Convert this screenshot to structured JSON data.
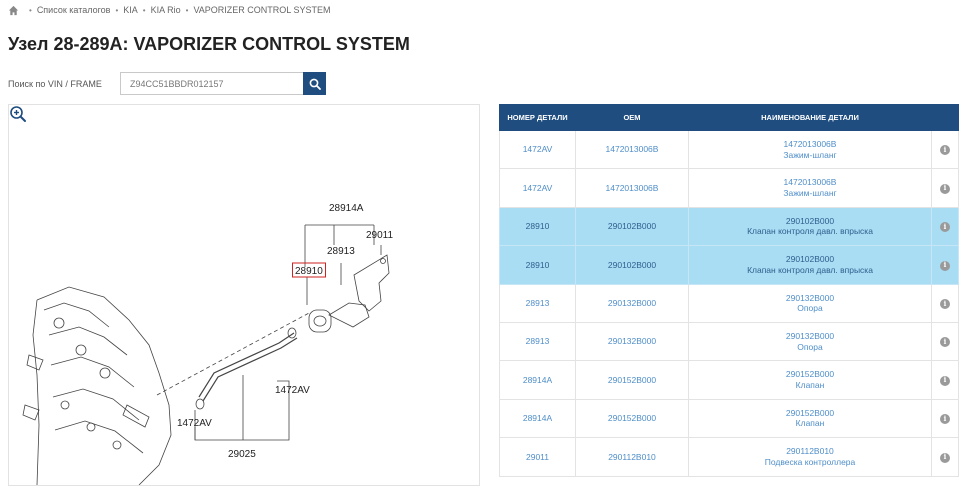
{
  "breadcrumb": {
    "items": [
      "Список каталогов",
      "KIA",
      "KIA Rio",
      "VAPORIZER CONTROL SYSTEM"
    ]
  },
  "page": {
    "title": "Узел 28-289A: VAPORIZER CONTROL SYSTEM"
  },
  "search": {
    "label": "Поиск по VIN / FRAME",
    "value": "Z94CC51BBDR012157",
    "icon": "search-icon"
  },
  "diagram": {
    "labels": {
      "l28914A": "28914A",
      "l28913": "28913",
      "l29011": "29011",
      "l28910": "28910",
      "l1472AV_right": "1472AV",
      "l1472AV_left": "1472AV",
      "l29025": "29025"
    },
    "zoom_icon": "zoom-in-icon",
    "highlight_color": "#cc2222"
  },
  "table": {
    "headers": {
      "part_number": "НОМЕР ДЕТАЛИ",
      "oem": "OEM",
      "name": "НАИМЕНОВАНИЕ ДЕТАЛИ"
    },
    "rows": [
      {
        "part": "1472AV",
        "oem": "1472013006B",
        "code": "1472013006B",
        "name": "Зажим-шланг",
        "highlighted": false
      },
      {
        "part": "1472AV",
        "oem": "1472013006B",
        "code": "1472013006B",
        "name": "Зажим-шланг",
        "highlighted": false
      },
      {
        "part": "28910",
        "oem": "290102B000",
        "code": "290102B000",
        "name": "Клапан контроля давл. впрыска",
        "highlighted": true
      },
      {
        "part": "28910",
        "oem": "290102B000",
        "code": "290102B000",
        "name": "Клапан контроля давл. впрыска",
        "highlighted": true
      },
      {
        "part": "28913",
        "oem": "290132B000",
        "code": "290132B000",
        "name": "Опора",
        "highlighted": false
      },
      {
        "part": "28913",
        "oem": "290132B000",
        "code": "290132B000",
        "name": "Опора",
        "highlighted": false
      },
      {
        "part": "28914A",
        "oem": "290152B000",
        "code": "290152B000",
        "name": "Клапан",
        "highlighted": false
      },
      {
        "part": "28914A",
        "oem": "290152B000",
        "code": "290152B000",
        "name": "Клапан",
        "highlighted": false
      },
      {
        "part": "29011",
        "oem": "290112B010",
        "code": "290112B010",
        "name": "Подвеска контроллера",
        "highlighted": false
      }
    ],
    "info_icon": "info-icon",
    "info_glyph": "i"
  },
  "colors": {
    "header_bg": "#1f4d7f",
    "link": "#4f8ec9",
    "row_highlight": "#a8ddf3"
  }
}
